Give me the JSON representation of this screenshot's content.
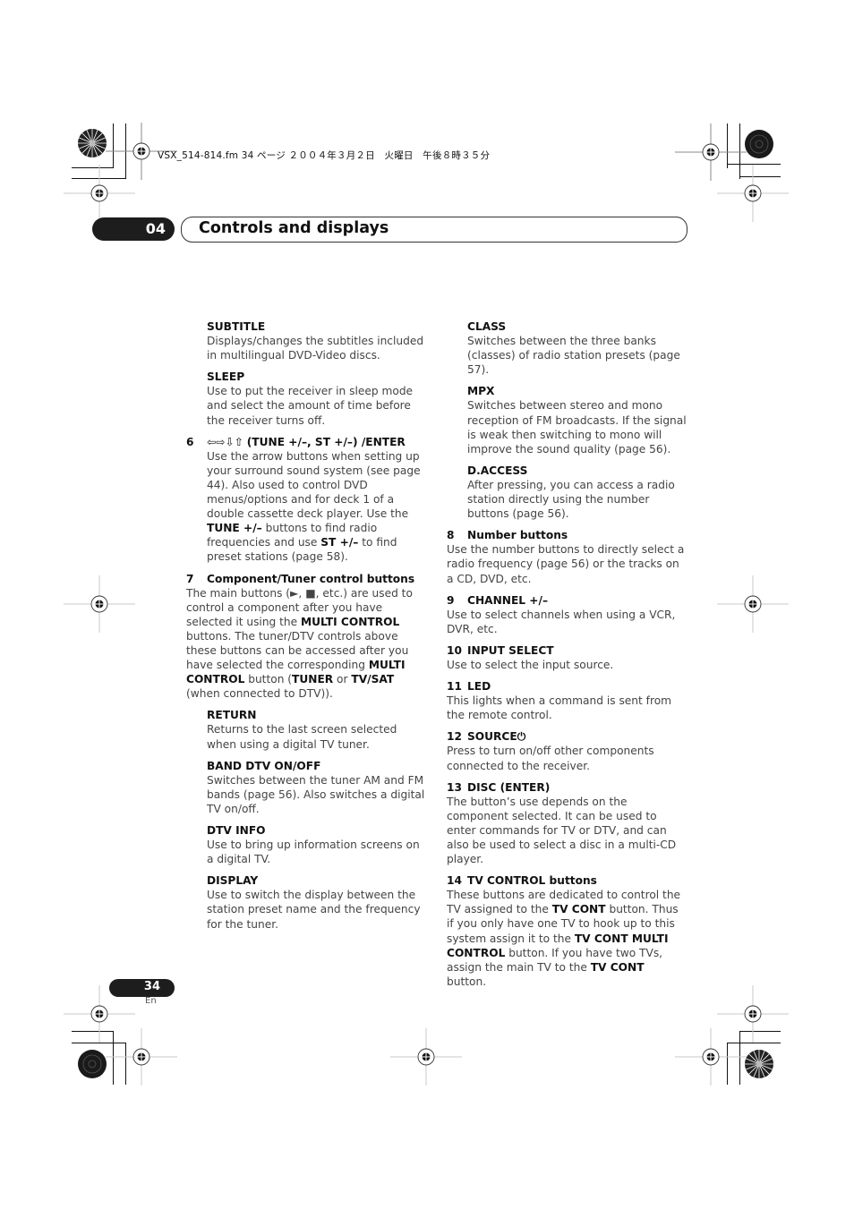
{
  "print_header": "VSX_514-814.fm  34 ページ  ２００４年３月２日　火曜日　午後８時３５分",
  "chapter": {
    "number": "04",
    "title": "Controls and displays"
  },
  "footer": {
    "page_number": "34",
    "language": "En"
  },
  "left_column": {
    "items": [
      {
        "title": "SUBTITLE",
        "body": "Displays/changes the subtitles included in multilingual DVD-Video discs."
      },
      {
        "title": "SLEEP",
        "body": "Use to put the receiver in sleep mode and select the amount of time before the receiver turns off."
      }
    ],
    "item6": {
      "number": "6",
      "arrows": "⇦⇨⇩⇧",
      "title": "(TUNE +/–, ST +/–) /ENTER",
      "body_1": "Use the arrow buttons when setting up your surround sound system (see page 44). Also used to control DVD menus/options and for deck 1 of a double cassette deck player. Use the ",
      "bold_1": "TUNE +/–",
      "body_2": " buttons to find radio frequencies and use ",
      "bold_2": "ST +/–",
      "body_3": " to find preset stations (page 58)."
    },
    "item7": {
      "number": "7",
      "title": "Component/Tuner control buttons",
      "body_1": "The main buttons (►, ■, etc.) are used to control a component after you have selected it using the ",
      "bold_1": "MULTI CONTROL",
      "body_2": " buttons. The tuner/DTV controls above these buttons can be accessed after you have selected the corresponding ",
      "bold_2": "MULTI CONTROL",
      "body_3": " button (",
      "bold_3": "TUNER",
      "body_4": " or ",
      "bold_4": "TV/SAT",
      "body_5": " (when connected to DTV)).",
      "subitems": [
        {
          "title": "RETURN",
          "body": "Returns to the last screen selected when using a digital TV tuner."
        },
        {
          "title": "BAND DTV ON/OFF",
          "body": "Switches between the tuner AM and FM bands (page 56). Also switches a digital TV on/off."
        },
        {
          "title": "DTV INFO",
          "body": "Use to bring up information screens on a digital TV."
        },
        {
          "title": "DISPLAY",
          "body": "Use to switch the display between the station preset name and the frequency for the tuner."
        }
      ]
    }
  },
  "right_column": {
    "subitems": [
      {
        "title": "CLASS",
        "body": "Switches between the three banks (classes) of radio station presets (page 57)."
      },
      {
        "title": "MPX",
        "body": "Switches between stereo and mono reception of FM broadcasts. If the signal is weak then switching to mono will improve the sound quality (page 56)."
      },
      {
        "title": "D.ACCESS",
        "body": "After pressing, you can access a radio station directly using the number buttons (page 56)."
      }
    ],
    "items": [
      {
        "number": "8",
        "title": "Number buttons",
        "body": "Use the number buttons to directly select a radio frequency (page 56) or the tracks on a CD, DVD, etc."
      },
      {
        "number": "9",
        "title": "CHANNEL +/–",
        "body": "Use to select channels when using a VCR, DVR, etc."
      },
      {
        "number": "10",
        "title": "INPUT SELECT",
        "body": "Use to select the input source."
      },
      {
        "number": "11",
        "title": "LED",
        "body": "This lights when a command is sent from the remote control."
      },
      {
        "number": "12",
        "title": "SOURCE⏻",
        "body": "Press to turn on/off other components connected to the receiver."
      },
      {
        "number": "13",
        "title": "DISC (ENTER)",
        "body": "The button’s use depends on the component selected. It can be used to enter commands for TV or DTV, and can also be used to select a disc in a multi-CD player."
      }
    ],
    "item14": {
      "number": "14",
      "title": "TV CONTROL buttons",
      "body_1": "These buttons are dedicated to control the TV assigned to the ",
      "bold_1": "TV CONT",
      "body_2": " button. Thus if you only have one TV to hook up to this system assign it to the ",
      "bold_2": "TV CONT MULTI CONTROL",
      "body_3": " button. If you have two TVs, assign the main TV to the ",
      "bold_3": "TV CONT",
      "body_4": " button."
    }
  }
}
